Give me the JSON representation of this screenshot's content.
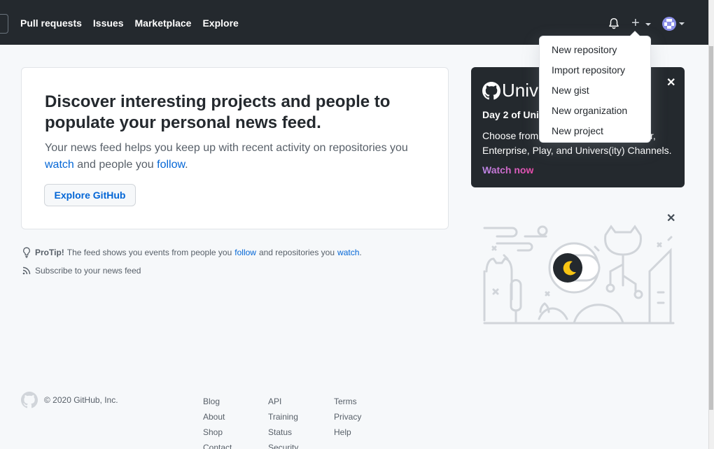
{
  "header": {
    "nav": [
      "Pull requests",
      "Issues",
      "Marketplace",
      "Explore"
    ]
  },
  "dropdown": {
    "items": [
      "New repository",
      "Import repository",
      "New gist",
      "New organization",
      "New project"
    ]
  },
  "feed_card": {
    "title": "Discover interesting projects and people to populate your personal news feed.",
    "desc_part1": "Your news feed helps you keep up with recent activity on repositories you",
    "watch_link": "watch",
    "desc_part2": "and people you",
    "follow_link": "follow",
    "desc_end": ".",
    "button": "Explore GitHub"
  },
  "protip": {
    "label": "ProTip!",
    "text1": "The feed shows you events from people you",
    "follow_link": "follow",
    "text2": "and repositories you",
    "watch_link": "watch",
    "end": "."
  },
  "subscribe": "Subscribe to your news feed",
  "promo": {
    "logo_text": "Unive",
    "day": "Day 2 of Univ",
    "desc_line1": "Choose from",
    "desc_line1_end": "r,",
    "desc_line2": "Enterprise, Play, and Univers(ity) Channels.",
    "watch": "Watch now"
  },
  "footer": {
    "copyright": "© 2020 GitHub, Inc.",
    "col1": [
      "Blog",
      "About",
      "Shop",
      "Contact"
    ],
    "col2": [
      "API",
      "Training",
      "Status",
      "Security"
    ],
    "col3": [
      "Terms",
      "Privacy",
      "Help"
    ]
  }
}
